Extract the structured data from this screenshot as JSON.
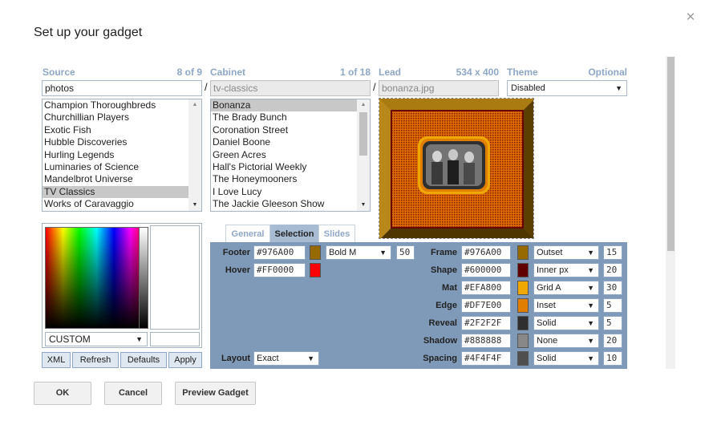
{
  "dialog": {
    "title": "Set up your gadget",
    "close_glyph": "×"
  },
  "source": {
    "label": "Source",
    "count": "8 of 9",
    "value": "photos",
    "items": [
      "Champion Thoroughbreds",
      "Churchillian Players",
      "Exotic Fish",
      "Hubble Discoveries",
      "Hurling Legends",
      "Luminaries of Science",
      "Mandelbrot Universe",
      "TV Classics",
      "Works of Caravaggio"
    ],
    "selected_index": 7
  },
  "cabinet": {
    "label": "Cabinet",
    "count": "1 of 18",
    "value": "tv-classics",
    "items": [
      "Bonanza",
      "The Brady Bunch",
      "Coronation Street",
      "Daniel Boone",
      "Green Acres",
      "Hall's Pictorial Weekly",
      "The Honeymooners",
      "I Love Lucy",
      "The Jackie Gleeson Show"
    ],
    "selected_index": 0
  },
  "lead": {
    "label": "Lead",
    "size": "534 x 400",
    "value": "bonanza.jpg"
  },
  "theme": {
    "label": "Theme",
    "note": "Optional",
    "value": "Disabled"
  },
  "separator": "/",
  "color_picker": {
    "mode": "CUSTOM"
  },
  "small_buttons": {
    "xml": "XML",
    "refresh": "Refresh",
    "defaults": "Defaults",
    "apply": "Apply"
  },
  "tabs": {
    "general": "General",
    "selection": "Selection",
    "slides": "Slides",
    "active": "Selection"
  },
  "left_rows": {
    "footer": {
      "label": "Footer",
      "hex": "#976A00",
      "color": "#976A00",
      "font": "Bold M",
      "size": "50"
    },
    "hover": {
      "label": "Hover",
      "hex": "#FF0000",
      "color": "#FF0000"
    },
    "layout": {
      "label": "Layout",
      "value": "Exact"
    }
  },
  "right_rows": [
    {
      "label": "Frame",
      "hex": "#976A00",
      "color": "#976A00",
      "style": "Outset",
      "num": "15"
    },
    {
      "label": "Shape",
      "hex": "#600000",
      "color": "#600000",
      "style": "Inner px",
      "num": "20"
    },
    {
      "label": "Mat",
      "hex": "#EFA800",
      "color": "#EFA800",
      "style": "Grid A",
      "num": "30"
    },
    {
      "label": "Edge",
      "hex": "#DF7E00",
      "color": "#DF7E00",
      "style": "Inset",
      "num": "5"
    },
    {
      "label": "Reveal",
      "hex": "#2F2F2F",
      "color": "#2F2F2F",
      "style": "Solid",
      "num": "5"
    },
    {
      "label": "Shadow",
      "hex": "#888888",
      "color": "#888888",
      "style": "None",
      "num": "20"
    },
    {
      "label": "Spacing",
      "hex": "#4F4F4F",
      "color": "#4F4F4F",
      "style": "Solid",
      "num": "10"
    }
  ],
  "footer_buttons": {
    "ok": "OK",
    "cancel": "Cancel",
    "preview": "Preview Gadget"
  },
  "icons": {
    "dropdown": "▼",
    "scroll_up": "▲",
    "scroll_down": "▼"
  }
}
